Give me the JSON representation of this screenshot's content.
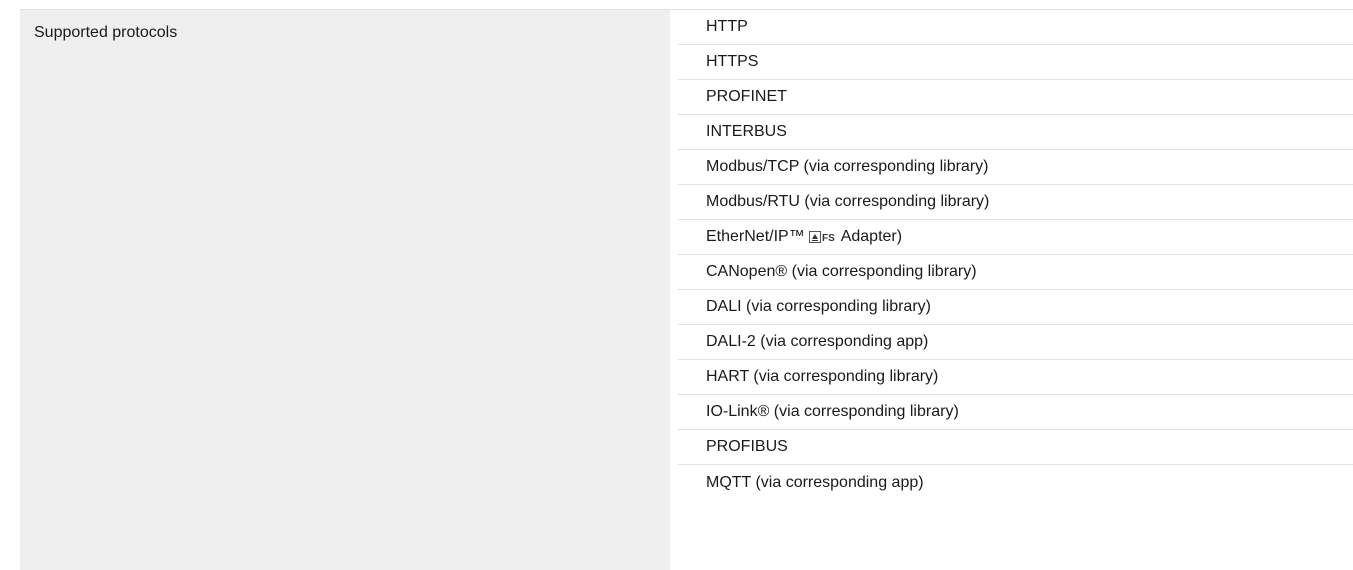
{
  "spec": {
    "label": "Supported protocols",
    "values": [
      "HTTP",
      "HTTPS",
      "PROFINET",
      "INTERBUS",
      "Modbus/TCP (via corresponding library)",
      "Modbus/RTU (via corresponding library)",
      "EtherNet/IP™",
      "CANopen® (via corresponding library)",
      "DALI (via corresponding library)",
      "DALI-2 (via corresponding app)",
      "HART (via corresponding library)",
      "IO-Link® (via corresponding library)",
      "PROFIBUS",
      "MQTT (via corresponding app)"
    ],
    "ethernet_ip_suffix": "Adapter)",
    "fs_badge_text": "FS"
  },
  "icons": {
    "fs_badge": "tuv-functional-safety-icon"
  }
}
